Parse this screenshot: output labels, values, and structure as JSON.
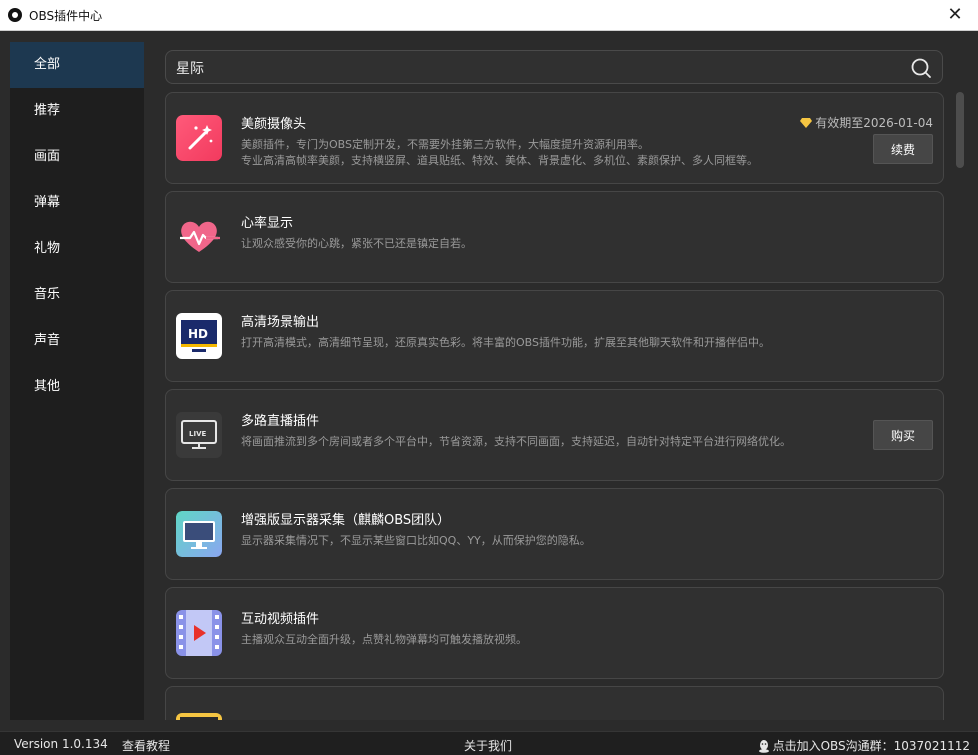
{
  "window": {
    "title": "OBS插件中心",
    "close_glyph": "✕"
  },
  "sidebar": {
    "items": [
      {
        "label": "全部",
        "active": true
      },
      {
        "label": "推荐"
      },
      {
        "label": "画面"
      },
      {
        "label": "弹幕"
      },
      {
        "label": "礼物"
      },
      {
        "label": "音乐"
      },
      {
        "label": "声音"
      },
      {
        "label": "其他"
      }
    ]
  },
  "search": {
    "value": "星际"
  },
  "plugins": [
    {
      "name": "美颜摄像头",
      "desc1": "美颜插件，专门为OBS定制开发，不需要外挂第三方软件，大幅度提升资源利用率。",
      "desc2": "专业高清高帧率美颜，支持横竖屏、道具贴纸、特效、美体、背景虚化、多机位、素颜保护、多人同框等。",
      "expiry": "有效期至2026-01-04",
      "button": "续费"
    },
    {
      "name": "心率显示",
      "desc1": "让观众感受你的心跳，紧张不已还是镇定自若。"
    },
    {
      "name": "高清场景输出",
      "desc1": "打开高清模式，高清细节呈现，还原真实色彩。将丰富的OBS插件功能，扩展至其他聊天软件和开播伴侣中。"
    },
    {
      "name": "多路直播插件",
      "desc1": "将画面推流到多个房间或者多个平台中，节省资源，支持不同画面，支持延迟，自动针对特定平台进行网络优化。",
      "button": "购买"
    },
    {
      "name": "增强版显示器采集（麒麟OBS团队）",
      "desc1": "显示器采集情况下，不显示某些窗口比如QQ、YY，从而保护您的隐私。"
    },
    {
      "name": "互动视频插件",
      "desc1": "主播观众互动全面升级，点赞礼物弹幕均可触发播放视频。"
    }
  ],
  "statusbar": {
    "version": "Version 1.0.134",
    "tutorial": "查看教程",
    "about": "关于我们",
    "group": "点击加入OBS沟通群：1037021112"
  },
  "colors": {
    "accent_active": "#1d3850",
    "background": "#2b2b2b",
    "card": "#303030"
  }
}
